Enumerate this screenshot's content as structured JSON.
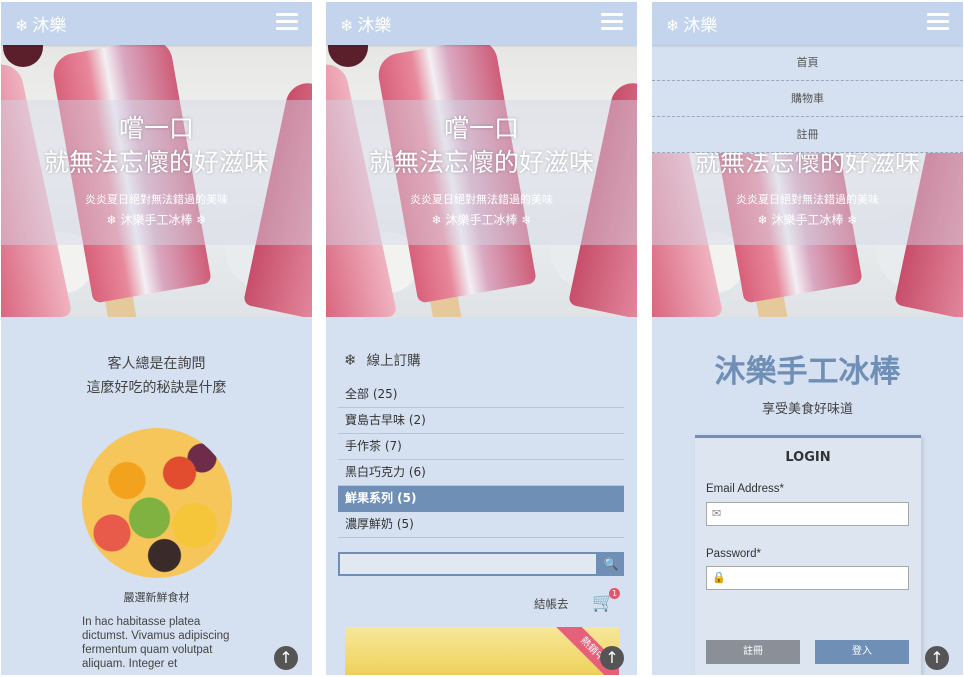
{
  "brand": {
    "name": "沐樂",
    "flake": "❄"
  },
  "hero": {
    "line1": "嚐一口",
    "line2": "就無法忘懷的好滋味",
    "sub1": "炎炎夏日絕對無法錯過的美味",
    "sub2": "❄ 沐樂手工冰棒 ❄"
  },
  "panel1": {
    "question_line1": "客人總是在詢問",
    "question_line2": "這麼好吃的秘訣是什麼",
    "caption": "嚴選新鮮食材",
    "body": "In hac habitasse platea dictumst. Vivamus adipiscing fermentum quam volutpat aliquam. Integer et"
  },
  "panel2": {
    "order_title": "線上訂購",
    "categories": [
      {
        "label": "全部 (25)",
        "active": false
      },
      {
        "label": "寶島古早味 (2)",
        "active": false
      },
      {
        "label": "手作茶 (7)",
        "active": false
      },
      {
        "label": "黑白巧克力 (6)",
        "active": false
      },
      {
        "label": "鮮果系列 (5)",
        "active": true
      },
      {
        "label": "濃厚鮮奶 (5)",
        "active": false
      }
    ],
    "checkout": "結帳去",
    "cart_count": "1",
    "ribbon": "熱銷中"
  },
  "panel3": {
    "menu": [
      "首頁",
      "購物車",
      "註冊"
    ],
    "title": "沐樂手工冰棒",
    "subtitle": "享受美食好味道",
    "login_title": "LOGIN",
    "email_label": "Email Address*",
    "password_label": "Password*",
    "register_button": "註冊",
    "login_button": "登入"
  }
}
